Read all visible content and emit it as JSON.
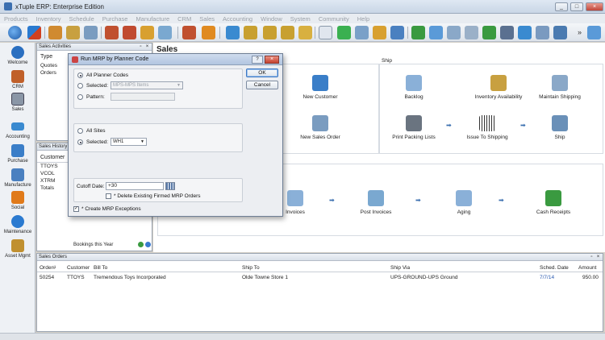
{
  "window": {
    "title": "xTuple ERP: Enterprise Edition",
    "buttons": [
      "_",
      "□",
      "×"
    ]
  },
  "menu": [
    "Products",
    "Inventory",
    "Schedule",
    "Purchase",
    "Manufacture",
    "CRM",
    "Sales",
    "Accounting",
    "Window",
    "System",
    "Community",
    "Help"
  ],
  "toolbar_more": "»",
  "sidebar": [
    {
      "label": "Welcome",
      "icon": "globe-icon",
      "color": "#2a6fc0"
    },
    {
      "label": "CRM",
      "icon": "people-icon",
      "color": "#c0602a"
    },
    {
      "label": "Sales",
      "icon": "tape-icon",
      "color": "#6a7480"
    },
    {
      "label": "Accounting",
      "icon": "book-icon",
      "color": "#3a8ad0"
    },
    {
      "label": "Purchase",
      "icon": "cart-icon",
      "color": "#3a7ec8"
    },
    {
      "label": "Manufacture",
      "icon": "factory-icon",
      "color": "#4a80c0"
    },
    {
      "label": "Social",
      "icon": "social-icon",
      "color": "#e07a1a"
    },
    {
      "label": "Maintenance",
      "icon": "gear-icon",
      "color": "#2a7ad0"
    },
    {
      "label": "Asset Mgmt",
      "icon": "assets-icon",
      "color": "#c09030"
    }
  ],
  "sales_activities": {
    "title": "Sales Activities",
    "column": "Type",
    "rows": [
      "Quotes",
      "Orders"
    ]
  },
  "sales_history": {
    "title": "Sales History",
    "column": "Customer",
    "rows": [
      "TTOYS",
      "VCOL",
      "XTRM",
      "Totals"
    ],
    "footer": "Bookings this Year"
  },
  "main": {
    "header": "Sales",
    "ship_group": "Ship",
    "actions": {
      "new_customer": "New Customer",
      "new_sales_order": "New Sales Order",
      "backlog": "Backlog",
      "inventory_availability": "Inventory Availability",
      "maintain_shipping": "Maintain Shipping",
      "print_packing_lists": "Print Packing Lists",
      "issue_to_shipping": "Issue To Shipping",
      "ship": "Ship",
      "invoices": "Invoices",
      "post_invoices": "Post Invoices",
      "aging": "Aging",
      "cash_receipts": "Cash Receipts"
    }
  },
  "dialog": {
    "title": "Run MRP by Planner Code",
    "help_button": "?",
    "close_button": "×",
    "all_planner_codes": "All Planner Codes",
    "selected_label": "Selected:",
    "planner_code_value": "MPS-MPS Items",
    "pattern_label": "Pattern:",
    "all_sites": "All Sites",
    "site_selected_label": "Selected:",
    "site_value": "WH1",
    "cutoff_label": "Cutoff Date:",
    "cutoff_value": "+30",
    "delete_firmed": "* Delete Existing Firmed MRP Orders",
    "create_exceptions": "* Create MRP Exceptions",
    "ok": "OK",
    "cancel": "Cancel"
  },
  "sales_orders": {
    "title": "Sales Orders",
    "columns": [
      "Order#",
      "Customer",
      "Bill To",
      "Ship To",
      "Ship Via",
      "Sched. Date",
      "Amount"
    ],
    "rows": [
      [
        "50254",
        "TTOYS",
        "Tremendous Toys Incorporated",
        "Olde Towne Store 1",
        "UPS-GROUND-UPS Ground",
        "7/7/14",
        "950.00"
      ]
    ]
  }
}
